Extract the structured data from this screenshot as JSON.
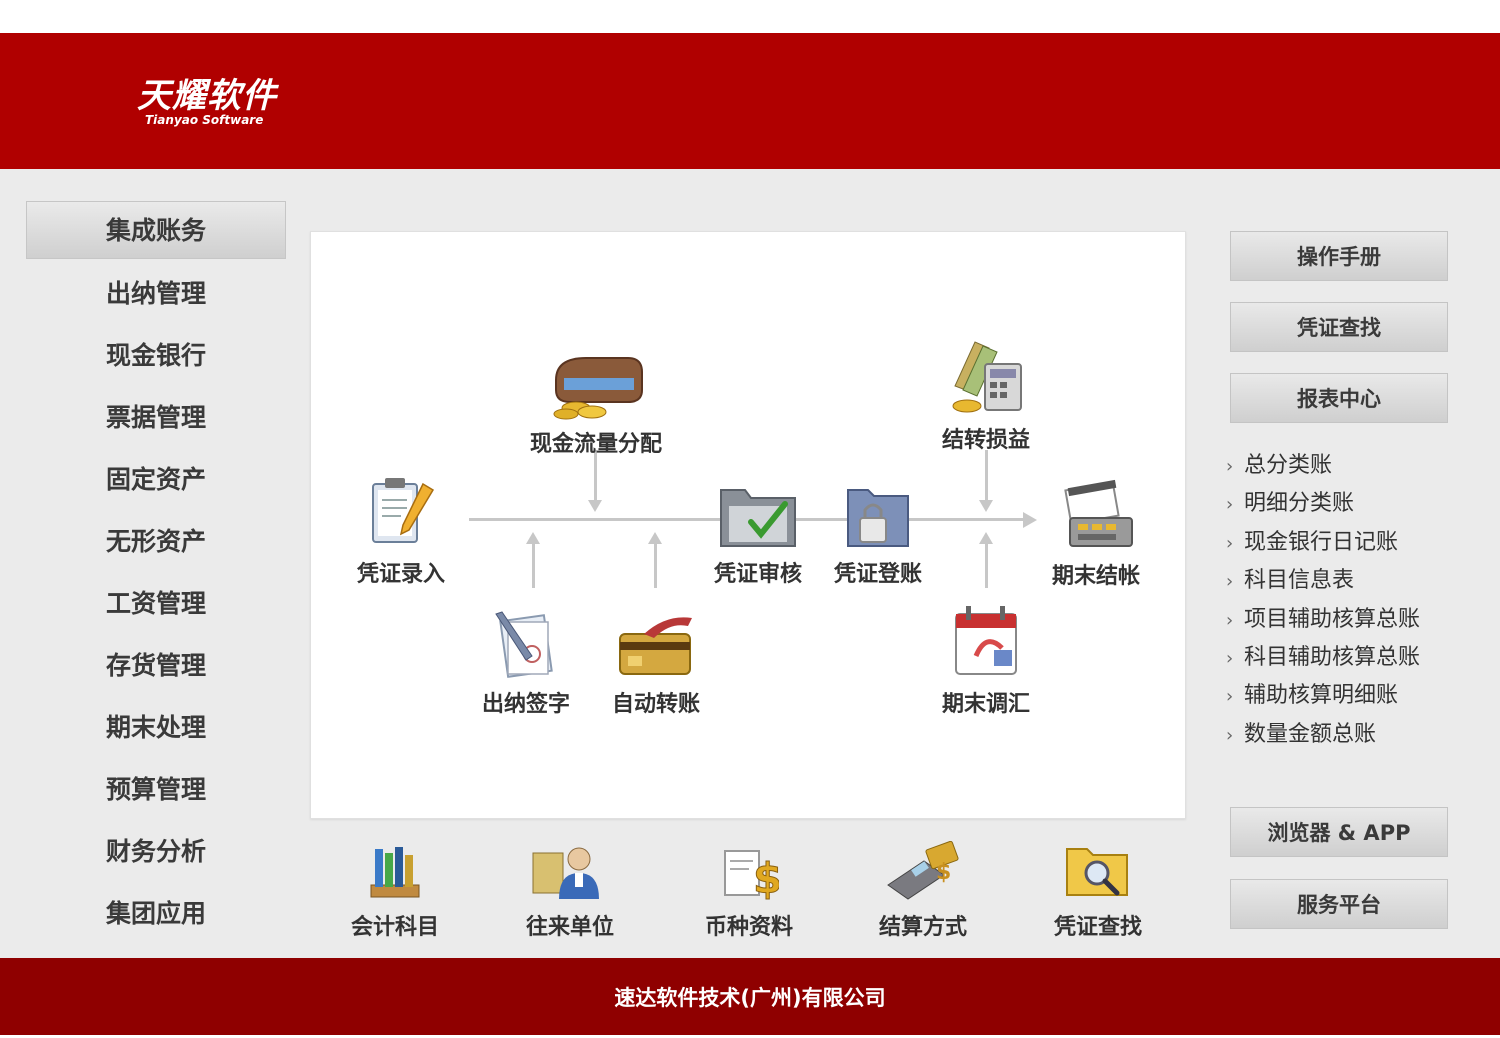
{
  "brand": {
    "name_cn": "天耀软件",
    "name_en": "Tianyao Software"
  },
  "left_nav": [
    {
      "label": "集成账务",
      "active": true
    },
    {
      "label": "出纳管理"
    },
    {
      "label": "现金银行"
    },
    {
      "label": "票据管理"
    },
    {
      "label": "固定资产"
    },
    {
      "label": "无形资产"
    },
    {
      "label": "工资管理"
    },
    {
      "label": "存货管理"
    },
    {
      "label": "期末处理"
    },
    {
      "label": "预算管理"
    },
    {
      "label": "财务分析"
    },
    {
      "label": "集团应用"
    }
  ],
  "flow": {
    "voucher_entry": {
      "label": "凭证录入",
      "icon": "clipboard-pencil-icon"
    },
    "cashflow_alloc": {
      "label": "现金流量分配",
      "icon": "wallet-coins-icon"
    },
    "cashier_sign": {
      "label": "出纳签字",
      "icon": "document-pen-icon"
    },
    "auto_transfer": {
      "label": "自动转账",
      "icon": "bank-card-icon"
    },
    "voucher_audit": {
      "label": "凭证审核",
      "icon": "folder-check-icon"
    },
    "voucher_post": {
      "label": "凭证登账",
      "icon": "folder-lock-icon"
    },
    "pl_transfer": {
      "label": "结转损益",
      "icon": "cash-calculator-icon"
    },
    "period_adjust": {
      "label": "期末调汇",
      "icon": "calendar-icon"
    },
    "period_close": {
      "label": "期末结帐",
      "icon": "cash-register-icon"
    }
  },
  "bottom_icons": [
    {
      "label": "会计科目",
      "icon": "bookshelf-icon"
    },
    {
      "label": "往来单位",
      "icon": "users-icon"
    },
    {
      "label": "币种资料",
      "icon": "dollar-doc-icon"
    },
    {
      "label": "结算方式",
      "icon": "pos-terminal-icon"
    },
    {
      "label": "凭证查找",
      "icon": "folder-search-icon"
    }
  ],
  "right_buttons": {
    "manual": "操作手册",
    "voucher_search": "凭证查找",
    "report_center": "报表中心",
    "browser_app": "浏览器 & APP",
    "service": "服务平台"
  },
  "report_links": [
    "总分类账",
    "明细分类账",
    "现金银行日记账",
    "科目信息表",
    "项目辅助核算总账",
    "科目辅助核算总账",
    "辅助核算明细账",
    "数量金额总账"
  ],
  "footer": {
    "company": "速达软件技术(广州)有限公司"
  },
  "colors": {
    "header": "#b00000",
    "footer": "#8f0000",
    "panel_bg": "#ebebeb"
  }
}
